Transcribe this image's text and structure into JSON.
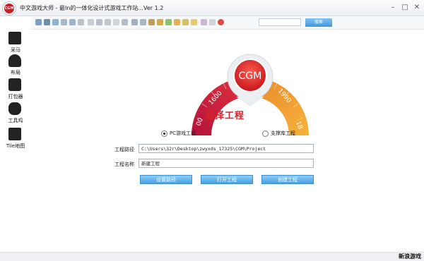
{
  "window": {
    "logo_text": "CGM",
    "title": "中文游戏大师 - 最In的一体化设计式游戏工作站...Ver 1.2",
    "minimize_glyph": "–",
    "maximize_glyph": "□",
    "close_glyph": "✕"
  },
  "toolbar": {
    "search_placeholder": "",
    "search_button": "搜索"
  },
  "sidebar": {
    "items": [
      {
        "label": "采马",
        "icon": "horse-icon"
      },
      {
        "label": "布局",
        "icon": "layout-icon"
      },
      {
        "label": "打包器",
        "icon": "packager-icon"
      },
      {
        "label": "工具鸡",
        "icon": "tool-icon"
      },
      {
        "label": "Tile地图",
        "icon": "tilemap-icon"
      }
    ]
  },
  "main": {
    "gauge": {
      "center_text": "CGM",
      "tick_labels": [
        "00",
        "1600",
        "1990",
        "18"
      ]
    },
    "heading": "选择工程",
    "project_types": [
      {
        "label": "PC游戏工程",
        "selected": true
      },
      {
        "label": "支撑库工程",
        "selected": false
      }
    ],
    "path_label": "工程路径",
    "path_value": "C:\\Users\\32r\\Desktop\\zwyxds_17325\\CGM\\Project",
    "name_label": "工程名称",
    "name_value": "新建工程",
    "buttons": {
      "set_path": "设置路径",
      "open_project": "打开工程",
      "create_project": "创建工程"
    }
  },
  "watermark": "新浪游戏",
  "colors": {
    "accent": "#d5232a",
    "button": "#4aa0e2",
    "gauge_orange": "#f39a2c"
  }
}
